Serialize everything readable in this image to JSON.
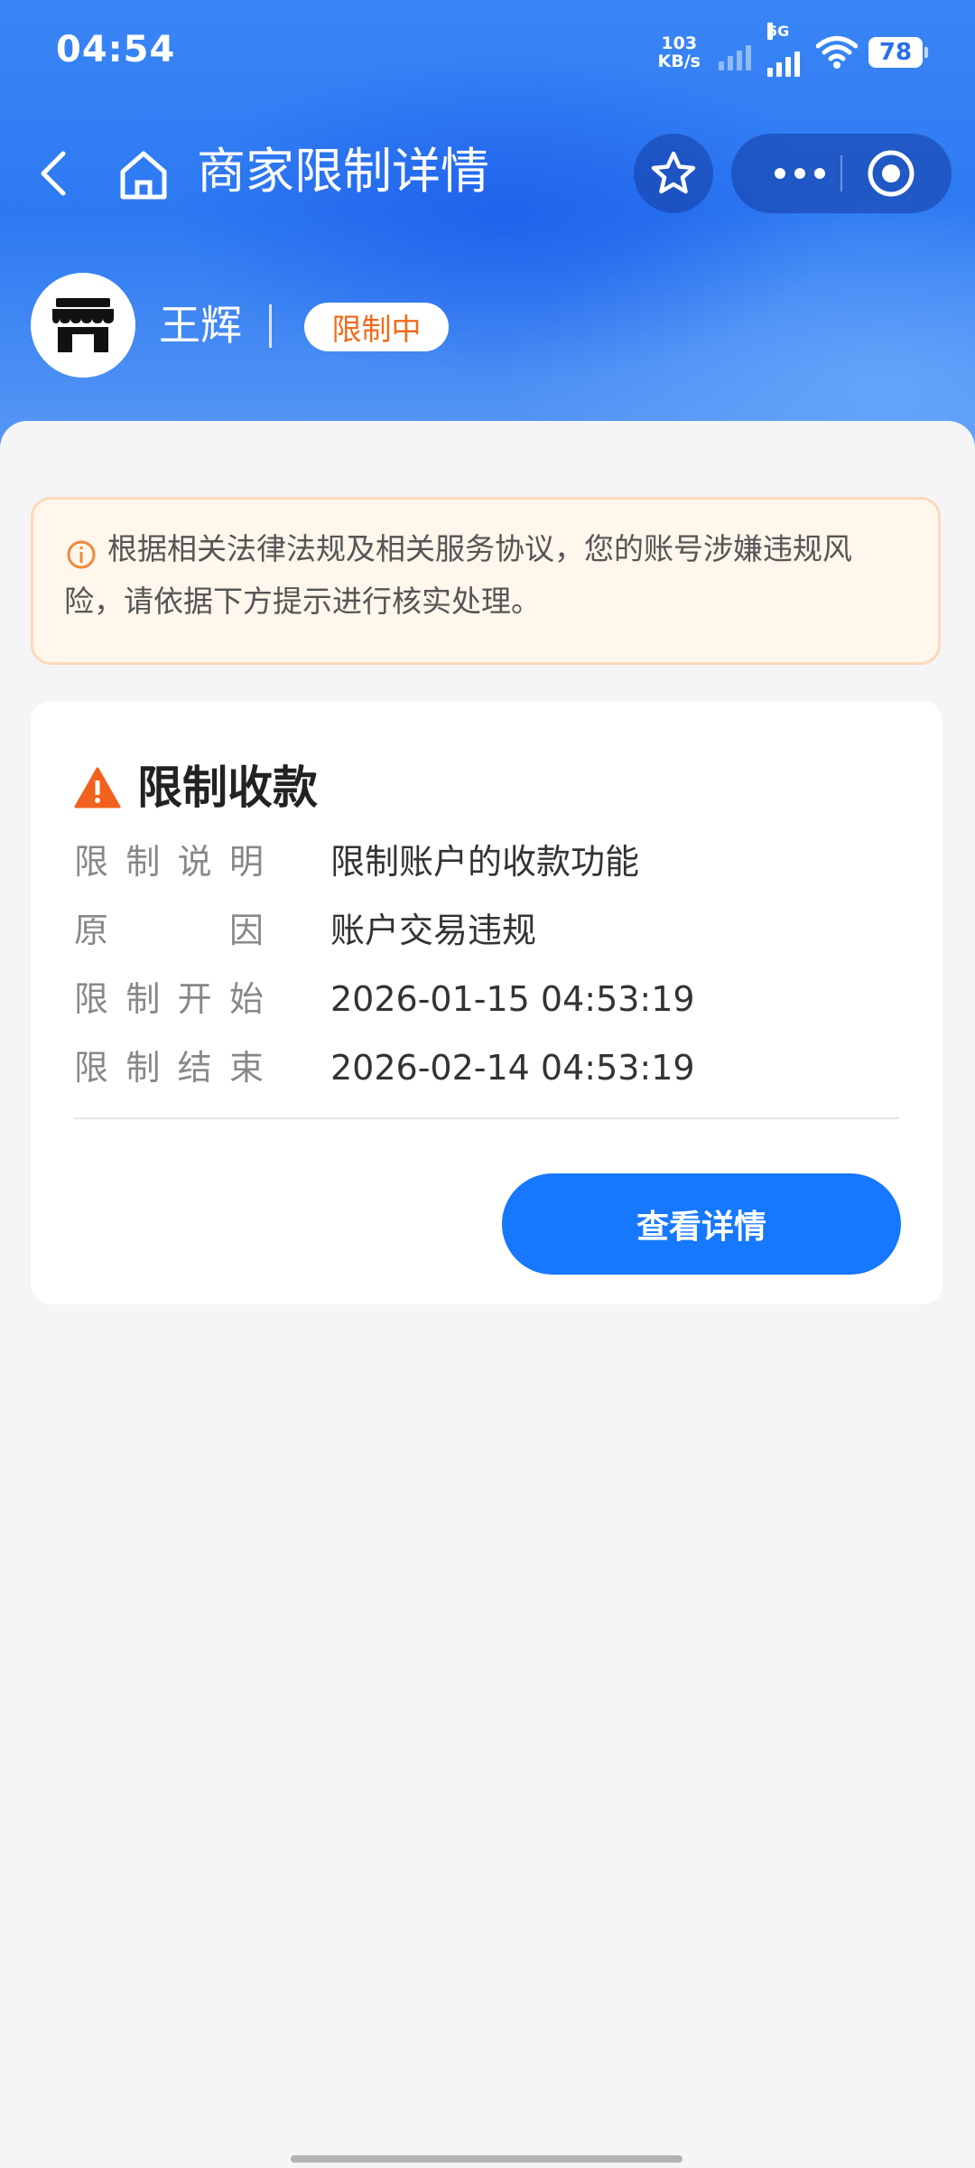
{
  "status_bar": {
    "time": "04:54",
    "net_speed_value": "103",
    "net_speed_unit": "KB/s",
    "network_type": "5G",
    "battery": "78"
  },
  "nav": {
    "title": "商家限制详情"
  },
  "merchant": {
    "name": "王辉",
    "status_badge": "限制中",
    "status_color": "#f26a1b"
  },
  "notice": {
    "text": "根据相关法律法规及相关服务协议，您的账号涉嫌违规风险，请依据下方提示进行核实处理。"
  },
  "restriction": {
    "title": "限制收款",
    "rows": [
      {
        "label_chars": [
          "限",
          "制",
          "说",
          "明"
        ],
        "value": "限制账户的收款功能"
      },
      {
        "label_chars": [
          "原",
          "因"
        ],
        "value": "账户交易违规"
      },
      {
        "label_chars": [
          "限",
          "制",
          "开",
          "始"
        ],
        "value": "2026-01-15 04:53:19"
      },
      {
        "label_chars": [
          "限",
          "制",
          "结",
          "束"
        ],
        "value": "2026-02-14 04:53:19"
      }
    ],
    "detail_button": "查看详情"
  },
  "colors": {
    "primary": "#1677ff",
    "header_blue": "#2d79f2",
    "warning_orange": "#f26a1b",
    "notice_bg": "#fff6ec"
  },
  "icons": [
    "back-arrow-icon",
    "home-icon",
    "star-icon",
    "more-icon",
    "target-icon",
    "store-icon",
    "info-icon",
    "warning-icon"
  ]
}
